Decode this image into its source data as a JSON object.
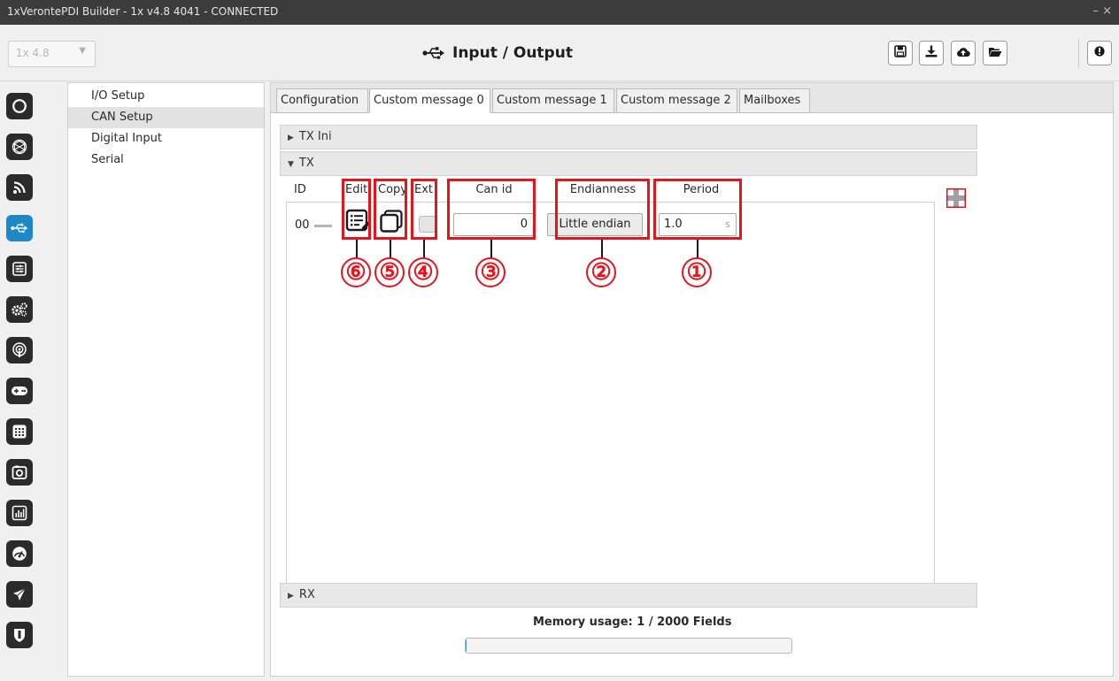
{
  "window": {
    "title": "1xVerontePDI Builder - 1x v4.8 4041 - CONNECTED",
    "controls": "– ×"
  },
  "header": {
    "version_select": "1x 4.8",
    "page_title": "Input / Output",
    "icons": [
      "save-icon",
      "download-icon",
      "cloud-upload-icon",
      "folder-open-icon",
      "info-icon"
    ]
  },
  "rail": {
    "icons": [
      "power-icon",
      "radar-icon",
      "signal-icon",
      "usb-icon",
      "sliders-icon",
      "gears-icon",
      "broadcast-icon",
      "gamepad-icon",
      "grid-icon",
      "camera-icon",
      "chart-icon",
      "gauge-icon",
      "plane-icon",
      "shield-icon"
    ],
    "active_icon": "usb-icon"
  },
  "sections": {
    "items": [
      "I/O Setup",
      "CAN Setup",
      "Digital Input",
      "Serial"
    ],
    "selected": "CAN Setup"
  },
  "tabs": {
    "items": [
      "Configuration",
      "Custom message 0",
      "Custom message 1",
      "Custom message 2",
      "Mailboxes"
    ],
    "active": "Custom message 0"
  },
  "panels": {
    "tx_ini": "TX Ini",
    "tx": "TX",
    "rx": "RX"
  },
  "table": {
    "headers": {
      "id": "ID",
      "edit": "Edit",
      "copy": "Copy",
      "ext": "Ext",
      "can_id": "Can id",
      "endianness": "Endianness",
      "period": "Period"
    },
    "row": {
      "id": "00",
      "ext_checked": false,
      "can_id": "0",
      "endianness": "Little endian",
      "period": "1.0",
      "period_unit": "s"
    }
  },
  "callouts": [
    "①",
    "②",
    "③",
    "④",
    "⑤",
    "⑥"
  ],
  "memory": {
    "label": "Memory usage: 1 / 2000 Fields",
    "used": 1,
    "total": 2000
  },
  "colors": {
    "accent": "#1e88c7",
    "highlight": "#e8141c",
    "rail_button": "#2b2b2b"
  }
}
